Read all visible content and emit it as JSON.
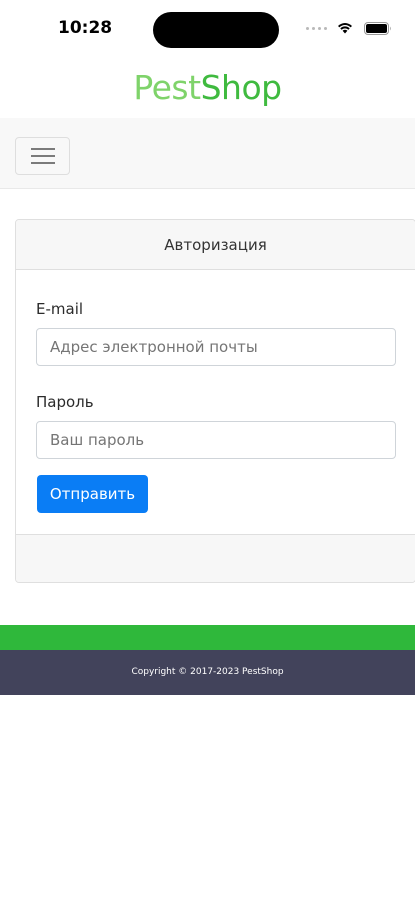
{
  "status_bar": {
    "time": "10:28"
  },
  "header": {
    "logo_part1": "Pest",
    "logo_part2": "Shop"
  },
  "navbar": {
    "toggler_icon": "hamburger-menu-icon"
  },
  "auth_card": {
    "title": "Авторизация",
    "email_label": "E-mail",
    "email_placeholder": "Адрес электронной почты",
    "email_value": "",
    "password_label": "Пароль",
    "password_placeholder": "Ваш пароль",
    "password_value": "",
    "submit_label": "Отправить"
  },
  "footer": {
    "copyright": "Copyright © 2017-2023 PestShop"
  },
  "colors": {
    "brand_green": "#3fba3f",
    "brand_green_light": "#7fd36a",
    "footer_stripe": "#2fb83b",
    "footer_bg": "#42435b",
    "primary_button": "#0a7df5"
  }
}
